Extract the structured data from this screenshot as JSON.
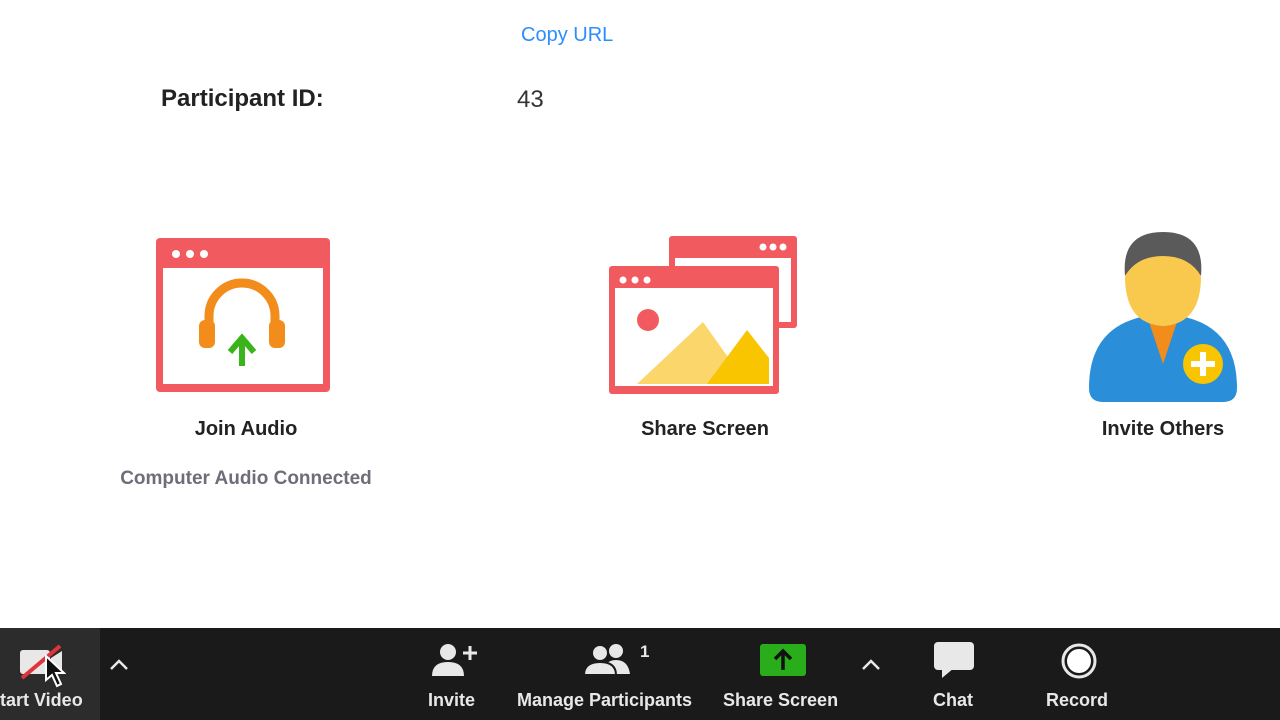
{
  "header": {
    "copy_url": "Copy URL",
    "participant_id_label": "Participant ID:",
    "participant_id_value": "43"
  },
  "actions": {
    "join_audio": {
      "label": "Join Audio",
      "status": "Computer Audio Connected",
      "icon": "headphones-icon"
    },
    "share_screen": {
      "label": "Share Screen",
      "icon": "share-screen-windows-icon"
    },
    "invite_others": {
      "label": "Invite Others",
      "icon": "add-person-icon"
    }
  },
  "toolbar": {
    "start_video": "tart Video",
    "invite": "Invite",
    "manage_participants": "Manage Participants",
    "participant_count": "1",
    "share_screen": "Share Screen",
    "chat": "Chat",
    "record": "Record"
  },
  "colors": {
    "link": "#2d8cff",
    "toolbar_bg": "#1a1a1a",
    "share_green": "#2aad1a",
    "window_red": "#f15b5f"
  }
}
